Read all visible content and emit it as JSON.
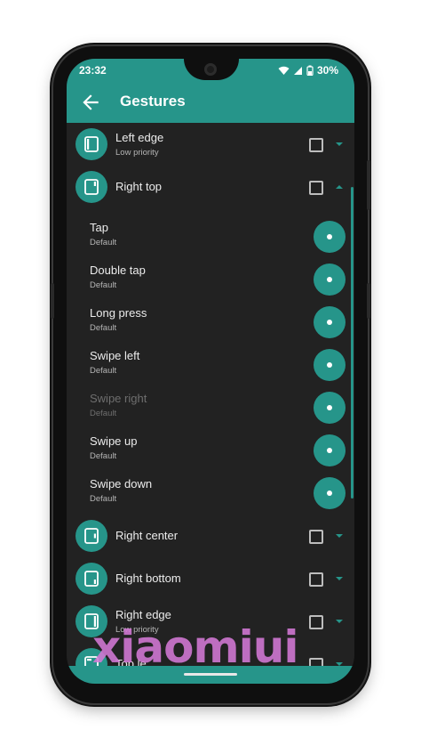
{
  "status": {
    "time": "23:32",
    "battery": "30%"
  },
  "appbar": {
    "title": "Gestures"
  },
  "groups_top": [
    {
      "title": "Left edge",
      "subtitle": "Low priority",
      "expanded": false
    },
    {
      "title": "Right top",
      "subtitle": "",
      "expanded": true
    }
  ],
  "sub_items": [
    {
      "title": "Tap",
      "subtitle": "Default",
      "enabled": true
    },
    {
      "title": "Double tap",
      "subtitle": "Default",
      "enabled": true
    },
    {
      "title": "Long press",
      "subtitle": "Default",
      "enabled": true
    },
    {
      "title": "Swipe left",
      "subtitle": "Default",
      "enabled": true
    },
    {
      "title": "Swipe right",
      "subtitle": "Default",
      "enabled": false
    },
    {
      "title": "Swipe up",
      "subtitle": "Default",
      "enabled": true
    },
    {
      "title": "Swipe down",
      "subtitle": "Default",
      "enabled": true
    }
  ],
  "groups_bottom": [
    {
      "title": "Right center",
      "subtitle": ""
    },
    {
      "title": "Right bottom",
      "subtitle": ""
    },
    {
      "title": "Right edge",
      "subtitle": "Low priority"
    },
    {
      "title": "Top le",
      "subtitle": ""
    }
  ],
  "watermark": "xiaomiui",
  "colors": {
    "accent": "#26958a",
    "background": "#222222",
    "watermark": "#d479d6"
  }
}
